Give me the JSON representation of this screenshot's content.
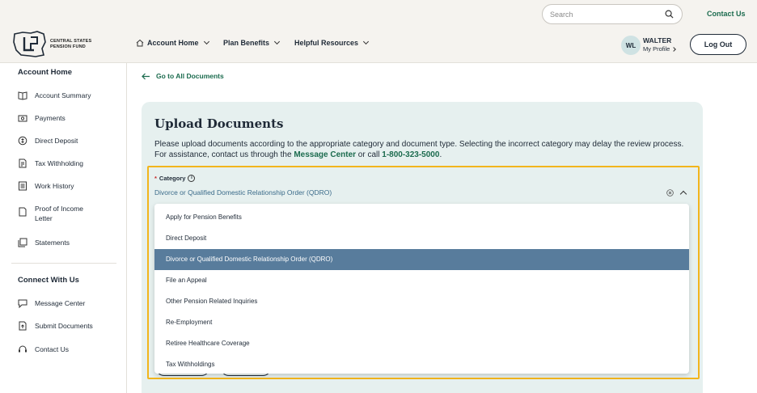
{
  "header": {
    "search_placeholder": "Search",
    "contact_link": "Contact Us",
    "logo_text_line1": "CENTRAL STATES",
    "logo_text_line2": "PENSION FUND",
    "nav": [
      {
        "label": "Account Home",
        "icon": "home-icon"
      },
      {
        "label": "Plan Benefits"
      },
      {
        "label": "Helpful Resources"
      }
    ],
    "user": {
      "initials": "WL",
      "name": "WALTER",
      "profile_link": "My Profile"
    },
    "logout_label": "Log Out"
  },
  "sidebar": {
    "section1_title": "Account Home",
    "items": [
      {
        "label": "Account Summary",
        "icon": "book-icon"
      },
      {
        "label": "Payments",
        "icon": "payments-icon"
      },
      {
        "label": "Direct Deposit",
        "icon": "bank-icon"
      },
      {
        "label": "Tax Withholding",
        "icon": "tax-icon"
      },
      {
        "label": "Work History",
        "icon": "list-icon"
      },
      {
        "label": "Proof of Income Letter",
        "icon": "document-icon"
      },
      {
        "label": "Statements",
        "icon": "statements-icon"
      }
    ],
    "section2_title": "Connect With Us",
    "connect_items": [
      {
        "label": "Message Center",
        "icon": "message-icon"
      },
      {
        "label": "Submit Documents",
        "icon": "upload-icon"
      },
      {
        "label": "Contact Us",
        "icon": "headset-icon"
      }
    ]
  },
  "main": {
    "back_link": "Go to All Documents",
    "title": "Upload Documents",
    "desc_part1": "Please upload documents according to the appropriate category and document type. Selecting the incorrect category may delay the review process. For assistance, contact us through the ",
    "desc_link1": "Message Center",
    "desc_part2": " or call ",
    "desc_link2": "1-800-323-5000",
    "desc_part3": ".",
    "category_label": "Category",
    "category_required": "*",
    "category_value": "Divorce or Qualified Domestic Relationship Order (QDRO)",
    "options": [
      "Apply for Pension Benefits",
      "Direct Deposit",
      "Divorce or Qualified Domestic Relationship Order (QDRO)",
      "File an Appeal",
      "Other Pension Related Inquiries",
      "Re-Employment",
      "Retiree Healthcare Coverage",
      "Tax Withholdings"
    ],
    "selected_index": 2
  },
  "colors": {
    "accent_green": "#1b6b4e",
    "selected_option": "#587c9c",
    "highlight": "#f2b51c",
    "panel_bg": "#e6f0ef"
  }
}
